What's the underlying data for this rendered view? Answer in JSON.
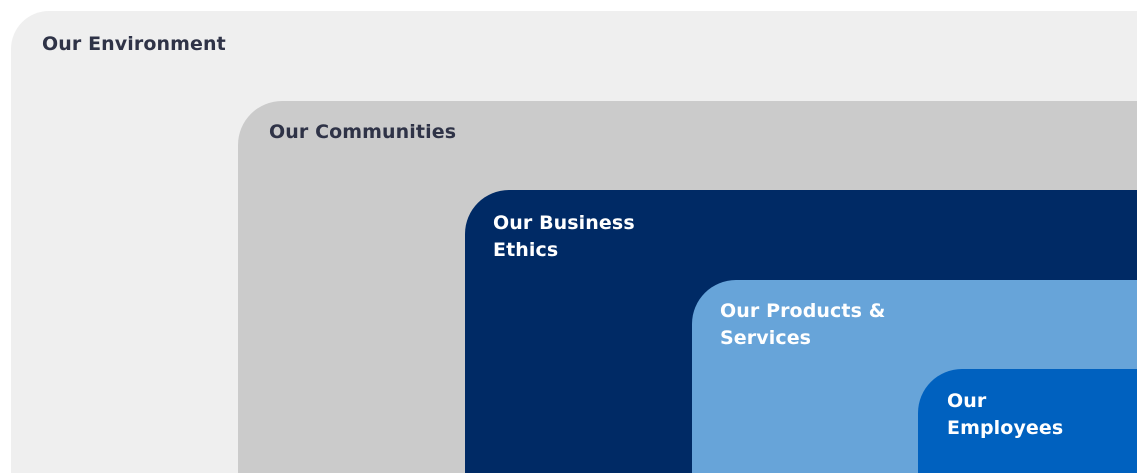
{
  "layers": [
    {
      "id": "environment",
      "label": "Our Environment",
      "background": "#efefef",
      "text_color": "#2f3347"
    },
    {
      "id": "communities",
      "label": "Our Communities",
      "background": "#cbcbcb",
      "text_color": "#2f3347"
    },
    {
      "id": "ethics",
      "label": "Our Business\nEthics",
      "background": "#002a65",
      "text_color": "#ffffff"
    },
    {
      "id": "products",
      "label": "Our Products &\nServices",
      "background": "#67a4d9",
      "text_color": "#ffffff"
    },
    {
      "id": "employees",
      "label": "Our\nEmployees",
      "background": "#0061bf",
      "text_color": "#ffffff"
    }
  ]
}
